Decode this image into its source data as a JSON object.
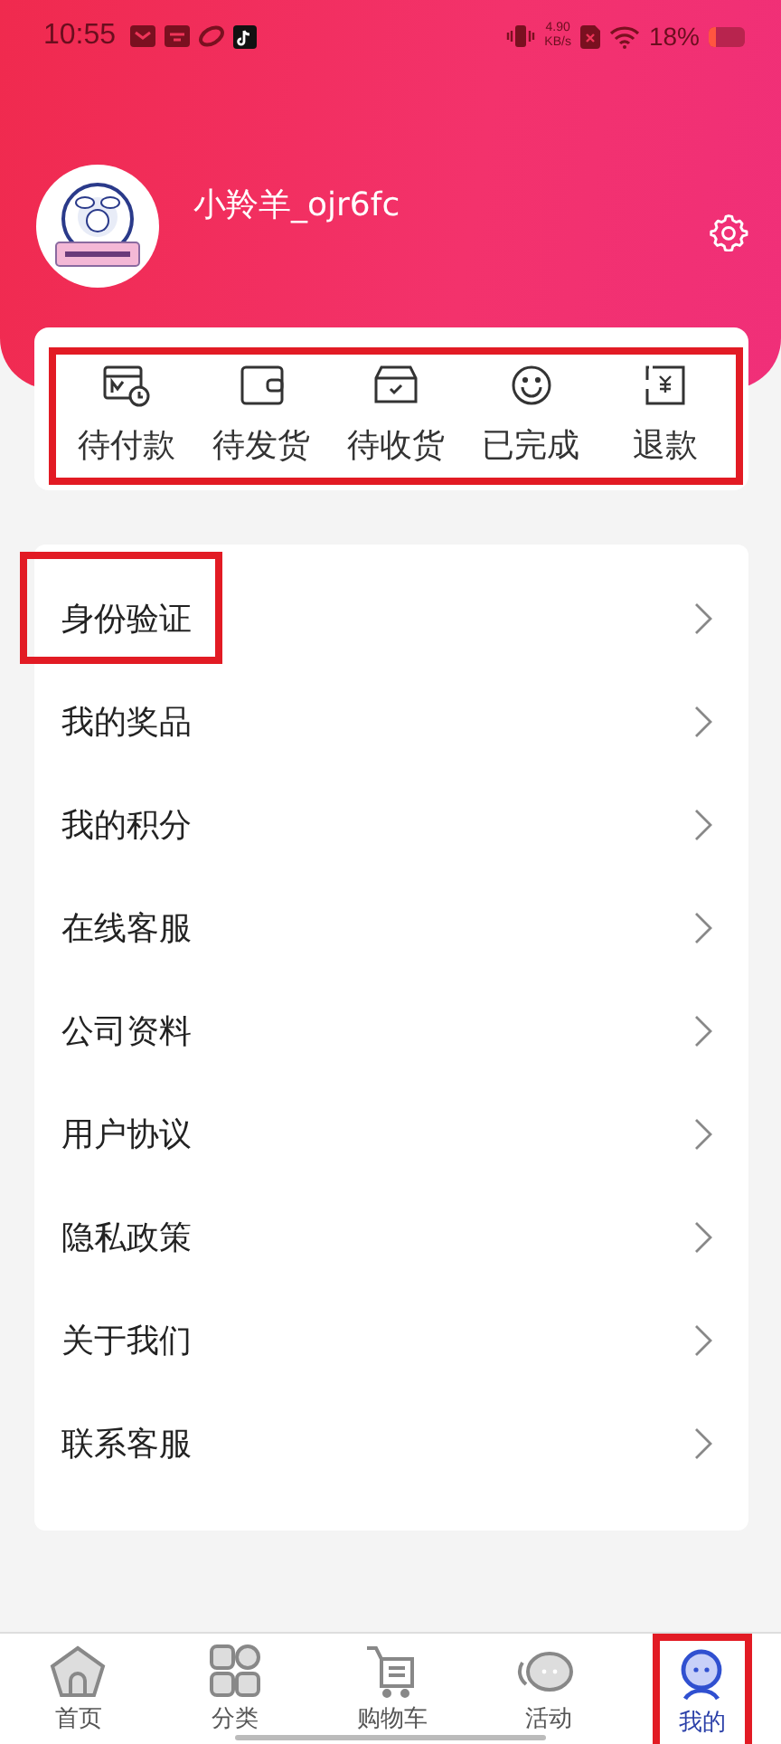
{
  "status_bar": {
    "time": "10:55",
    "speed": "4.90",
    "speed_unit": "KB/s",
    "battery": "18%"
  },
  "profile": {
    "username": "小羚羊_ojr6fc"
  },
  "orders": {
    "highlighted": true,
    "items": [
      {
        "label": "待付款",
        "kind": "pay"
      },
      {
        "label": "待发货",
        "kind": "wallet"
      },
      {
        "label": "待收货",
        "kind": "box"
      },
      {
        "label": "已完成",
        "kind": "smile"
      },
      {
        "label": "退款",
        "kind": "refund"
      }
    ]
  },
  "menu": [
    {
      "label": "身份验证",
      "highlighted": true
    },
    {
      "label": "我的奖品",
      "highlighted": false
    },
    {
      "label": "我的积分",
      "highlighted": false
    },
    {
      "label": "在线客服",
      "highlighted": false
    },
    {
      "label": "公司资料",
      "highlighted": false
    },
    {
      "label": "用户协议",
      "highlighted": false
    },
    {
      "label": "隐私政策",
      "highlighted": false
    },
    {
      "label": "关于我们",
      "highlighted": false
    },
    {
      "label": "联系客服",
      "highlighted": false
    }
  ],
  "tab_bar": [
    {
      "label": "首页",
      "kind": "home",
      "selected": false,
      "highlighted": false
    },
    {
      "label": "分类",
      "kind": "grid",
      "selected": false,
      "highlighted": false
    },
    {
      "label": "购物车",
      "kind": "cart",
      "selected": false,
      "highlighted": false
    },
    {
      "label": "活动",
      "kind": "chat",
      "selected": false,
      "highlighted": false
    },
    {
      "label": "我的",
      "kind": "user",
      "selected": true,
      "highlighted": true
    }
  ]
}
